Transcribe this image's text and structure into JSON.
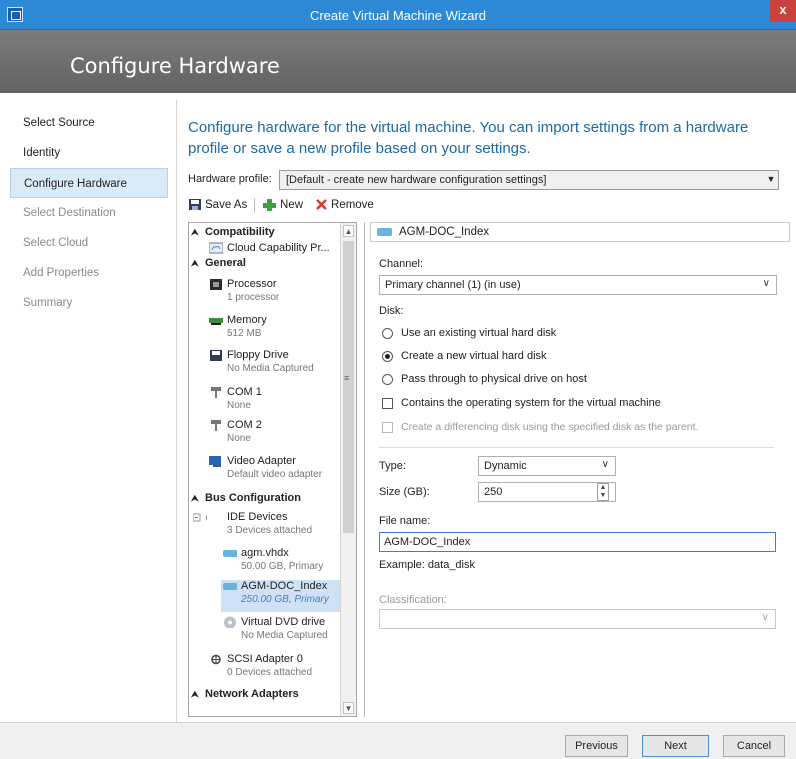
{
  "window": {
    "title": "Create Virtual Machine Wizard",
    "close_glyph": "x"
  },
  "header": {
    "title": "Configure Hardware"
  },
  "nav": {
    "items": [
      {
        "label": "Select Source",
        "state": "normal"
      },
      {
        "label": "Identity",
        "state": "normal"
      },
      {
        "label": "Configure Hardware",
        "state": "active"
      },
      {
        "label": "Select Destination",
        "state": "disabled"
      },
      {
        "label": "Select Cloud",
        "state": "disabled"
      },
      {
        "label": "Add Properties",
        "state": "disabled"
      },
      {
        "label": "Summary",
        "state": "disabled"
      }
    ]
  },
  "intro": "Configure hardware for the virtual machine. You can import settings from a hardware profile or save a new profile based on your settings.",
  "hardware_profile": {
    "label": "Hardware profile:",
    "value": "[Default - create new hardware configuration settings]"
  },
  "toolbar": {
    "save_as": "Save As",
    "new": "New",
    "remove": "Remove"
  },
  "hw_list": {
    "sections": {
      "compatibility": "Compatibility",
      "general": "General",
      "bus": "Bus Configuration",
      "network": "Network Adapters"
    },
    "items": {
      "cloud": {
        "name": "Cloud Capability Pr...",
        "sub": ""
      },
      "processor": {
        "name": "Processor",
        "sub": "1 processor"
      },
      "memory": {
        "name": "Memory",
        "sub": "512 MB"
      },
      "floppy": {
        "name": "Floppy Drive",
        "sub": "No Media Captured"
      },
      "com1": {
        "name": "COM 1",
        "sub": "None"
      },
      "com2": {
        "name": "COM 2",
        "sub": "None"
      },
      "video": {
        "name": "Video Adapter",
        "sub": "Default video adapter"
      },
      "ide": {
        "name": "IDE Devices",
        "sub": "3 Devices attached"
      },
      "agm_vhdx": {
        "name": "agm.vhdx",
        "sub": "50.00 GB, Primary"
      },
      "agm_doc": {
        "name": "AGM-DOC_Index",
        "sub": "250.00 GB, Primary"
      },
      "dvd": {
        "name": "Virtual DVD drive",
        "sub": "No Media Captured"
      },
      "scsi": {
        "name": "SCSI Adapter 0",
        "sub": "0 Devices attached"
      }
    }
  },
  "detail": {
    "header": "AGM-DOC_Index",
    "channel_label": "Channel:",
    "channel_value": "Primary channel (1) (in use)",
    "disk_label": "Disk:",
    "options": {
      "existing": "Use an existing virtual hard disk",
      "new": "Create a new virtual hard disk",
      "pass": "Pass through to physical drive on host"
    },
    "contains_os": "Contains the operating system for the virtual machine",
    "differencing": "Create a differencing disk using the specified disk as the parent.",
    "type_label": "Type:",
    "type_value": "Dynamic",
    "size_label": "Size (GB):",
    "size_value": "250",
    "filename_label": "File name:",
    "filename_value": "AGM-DOC_Index",
    "example": "Example: data_disk",
    "classification_label": "Classification:",
    "classification_value": ""
  },
  "buttons": {
    "previous": "Previous",
    "next": "Next",
    "cancel": "Cancel"
  }
}
